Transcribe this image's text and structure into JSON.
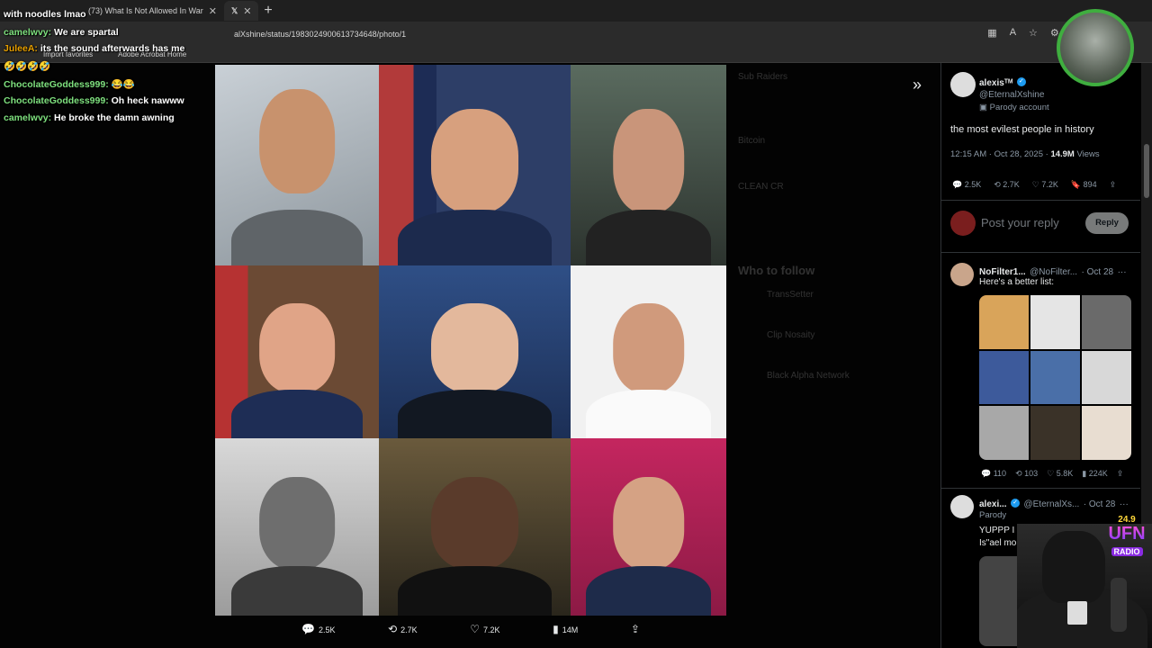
{
  "browser": {
    "tabs": [
      {
        "label": "(73) What Is Not Allowed In War",
        "active": false
      },
      {
        "label": "X",
        "active": true
      }
    ],
    "url": "alXshine/status/1983024900613734648/photo/1",
    "bookmarks": [
      "Import favorites",
      "Adobe Acrobat Home"
    ]
  },
  "chat": {
    "lines": [
      {
        "user": "",
        "message": "with noodles lmao"
      },
      {
        "user": "camelwvy:",
        "message": "We are spartal"
      },
      {
        "user": "JuleeA:",
        "message": "its the sound afterwards has me"
      },
      {
        "user": "",
        "message": "🤣🤣🤣🤣"
      },
      {
        "user": "ChocolateGoddess999:",
        "message": "😂😂"
      },
      {
        "user": "ChocolateGoddess999:",
        "message": "Oh heck nawww"
      },
      {
        "user": "camelwvy:",
        "message": "He broke the damn awning"
      }
    ]
  },
  "viewer": {
    "actions": [
      {
        "icon": "reply-icon",
        "count": "2.5K"
      },
      {
        "icon": "retweet-icon",
        "count": "2.7K"
      },
      {
        "icon": "like-icon",
        "count": "7.2K"
      },
      {
        "icon": "views-icon",
        "count": "14M"
      },
      {
        "icon": "share-icon",
        "count": ""
      }
    ],
    "background_sidebar": [
      "Sub Raiders",
      "Bitcoin",
      "CLEAN CR",
      "Who to follow",
      "TransSetter",
      "Clip Nosaity",
      "Black Alpha Network"
    ]
  },
  "tweet": {
    "author": "alexisᵀᴹ",
    "handle": "@EternalXshine",
    "badge": "Parody account",
    "text": "the most evilest people in history",
    "time": "12:15 AM · Oct 28, 2025 ·",
    "views_count": "14.9M",
    "views_label": "Views",
    "stats": {
      "replies": "2.5K",
      "retweets": "2.7K",
      "likes": "7.2K",
      "bookmarks": "894"
    },
    "reply_placeholder": "Post your reply",
    "reply_button": "Reply"
  },
  "replies": [
    {
      "author": "NoFilter1...",
      "handle": "@NoFilter...",
      "date": "· Oct 28",
      "text": "Here's a better list:",
      "stats": {
        "replies": "110",
        "retweets": "103",
        "likes": "5.8K",
        "views": "224K"
      }
    },
    {
      "author": "alexi...",
      "handle": "@EternalXs...",
      "date": "· Oct 28",
      "badge": "Parody",
      "text": "YUPPP I f",
      "text2": "Is\"ael mo"
    }
  ],
  "overlay": {
    "station_number": "24.9",
    "station_name": "UFN",
    "station_sub": "RADIO"
  },
  "colors": {
    "accent": "#1d9bf0",
    "chat_user": "#7ee07e",
    "ring": "#3fae3f"
  }
}
